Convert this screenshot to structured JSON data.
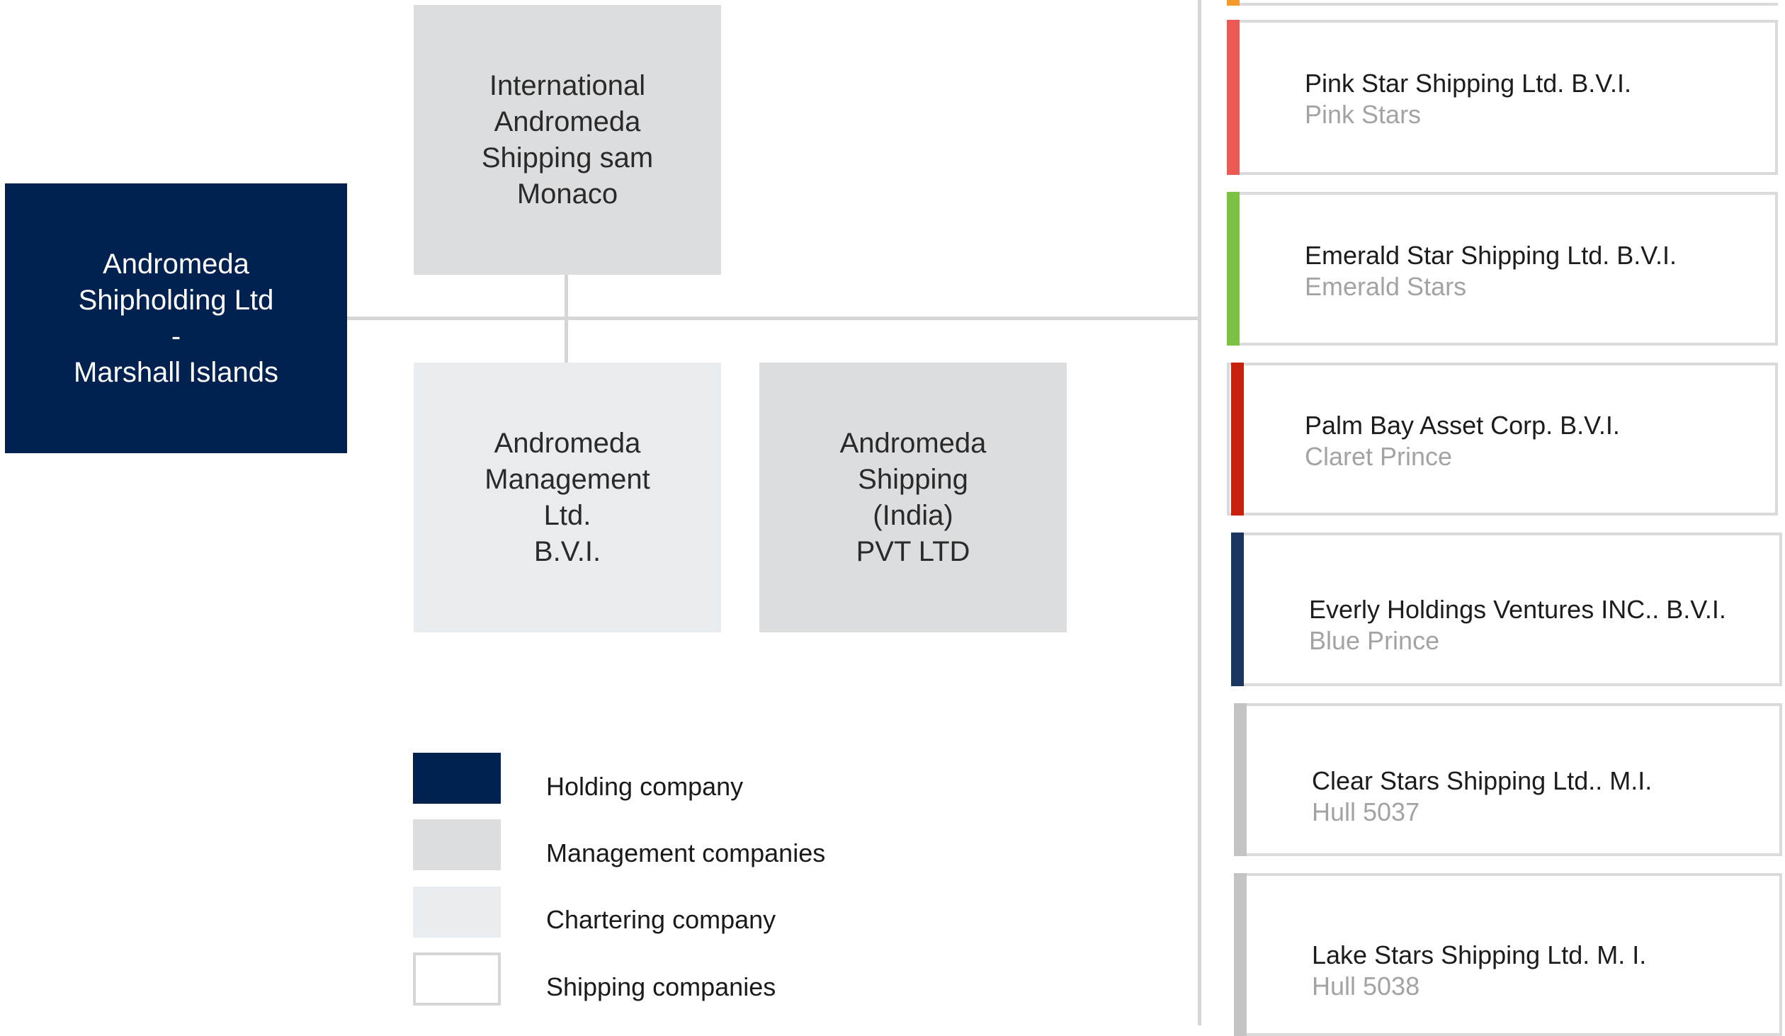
{
  "org": {
    "holding": {
      "lines": [
        "Andromeda",
        "Shipholding Ltd",
        "-",
        "Marshall Islands"
      ]
    },
    "management_monaco": {
      "lines": [
        "International",
        "Andromeda",
        "Shipping sam",
        "Monaco"
      ]
    },
    "chartering": {
      "lines": [
        "Andromeda",
        "Management",
        "Ltd.",
        "B.V.I."
      ]
    },
    "management_india": {
      "lines": [
        "Andromeda",
        "Shipping",
        "(India)",
        "PVT LTD"
      ]
    }
  },
  "legend": [
    {
      "label": "Holding company",
      "color": "#012150"
    },
    {
      "label": "Management companies",
      "color": "#dcdddf"
    },
    {
      "label": "Chartering company",
      "color": "#e9ecef"
    },
    {
      "label": "Shipping companies",
      "color": "#ffffff"
    }
  ],
  "ships": [
    {
      "company": "Pink Star Shipping Ltd. B.V.I.",
      "vessel": "Pink Stars",
      "color": "#ec5a55"
    },
    {
      "company": "Emerald Star Shipping Ltd. B.V.I.",
      "vessel": "Emerald Stars",
      "color": "#7cc242"
    },
    {
      "company": "Palm Bay Asset Corp. B.V.I.",
      "vessel": "Claret Prince",
      "color": "#c8220e"
    },
    {
      "company": "Everly Holdings Ventures INC.. B.V.I.",
      "vessel": "Blue Prince",
      "color": "#1a3560"
    },
    {
      "company": "Clear Stars Shipping Ltd.. M.I.",
      "vessel": "Hull 5037",
      "color": "#c3c3c3"
    },
    {
      "company": "Lake Stars Shipping Ltd. M. I.",
      "vessel": "Hull 5038",
      "color": "#c3c3c3"
    }
  ],
  "accent_top": "#f39a2b"
}
